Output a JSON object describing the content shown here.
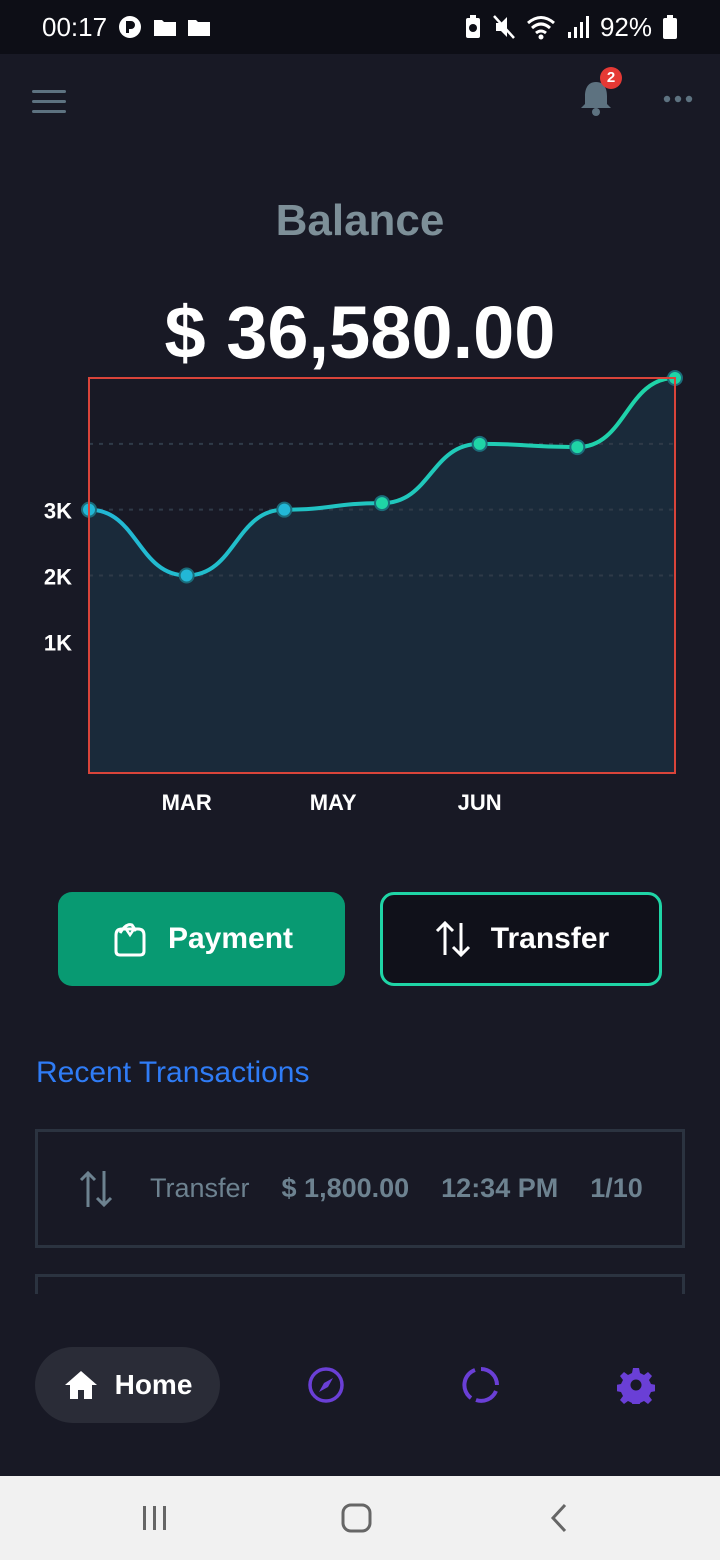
{
  "status_bar": {
    "time": "00:17",
    "battery": "92%"
  },
  "app_bar": {
    "notification_count": "2"
  },
  "balance": {
    "label": "Balance",
    "value": "$ 36,580.00"
  },
  "chart_data": {
    "type": "area",
    "x": [
      0,
      1,
      2,
      3,
      4,
      5,
      6
    ],
    "values": [
      3000,
      2000,
      3000,
      3100,
      4000,
      3950,
      5000
    ],
    "y_ticks": [
      {
        "label": "3K",
        "value": 3000
      },
      {
        "label": "2K",
        "value": 2000
      },
      {
        "label": "1K",
        "value": 1000
      }
    ],
    "x_ticks": [
      {
        "label": "MAR",
        "x": 1
      },
      {
        "label": "MAY",
        "x": 2.5
      },
      {
        "label": "JUN",
        "x": 4
      }
    ],
    "ylim": [
      -1000,
      5000
    ],
    "xlim": [
      0,
      6
    ],
    "line_color": "#22b7d6",
    "line_color_end": "#1fd5a6",
    "fill_color": "#1a2a3a",
    "frame_color": "#d9443a",
    "grid": true
  },
  "actions": {
    "payment_label": "Payment",
    "transfer_label": "Transfer"
  },
  "recent": {
    "title": "Recent Transactions",
    "transactions": [
      {
        "type": "Transfer",
        "amount": "$ 1,800.00",
        "time": "12:34 PM",
        "date": "1/10"
      }
    ]
  },
  "tabs": {
    "home_label": "Home"
  },
  "colors": {
    "background": "#181925",
    "accent_green": "#089a72",
    "accent_teal": "#1fd5a6",
    "link_blue": "#2f7cf6",
    "tab_purple": "#6a3fd6"
  }
}
